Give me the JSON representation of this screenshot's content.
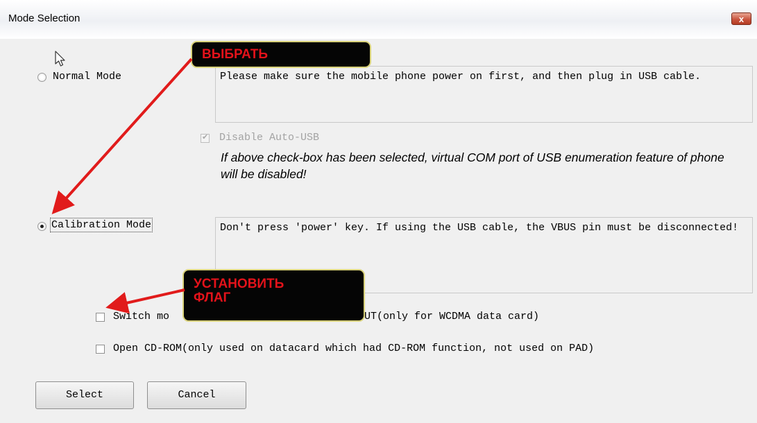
{
  "window": {
    "title": "Mode Selection",
    "close_glyph": "x"
  },
  "normal_mode": {
    "radio_label": "Normal Mode",
    "selected": false,
    "description": "Please make sure the mobile phone power on first, and then plug in USB cable."
  },
  "disable_auto_usb": {
    "label": "Disable Auto-USB",
    "checked": true,
    "enabled": false,
    "note": "If above check-box has been selected, virtual COM port of USB enumeration feature of phone will be disabled!"
  },
  "calibration_mode": {
    "radio_label": "Calibration Mode",
    "selected": true,
    "description": "Don't press 'power' key. If using the USB cable, the VBUS pin must be disconnected!"
  },
  "switch_option": {
    "label_start": "Switch mo",
    "label_end": "UT(only for WCDMA data card)",
    "checked": false
  },
  "cdrom_option": {
    "label": "Open CD-ROM(only used on datacard which  had CD-ROM function, not used on PAD)",
    "checked": false
  },
  "buttons": {
    "select": "Select",
    "cancel": "Cancel"
  },
  "annotations": {
    "select_callout": "ВЫБРАТЬ",
    "flag_callout_line1": "УСТАНОВИТЬ",
    "flag_callout_line2": "ФЛАГ",
    "arrow_color": "#e11b1b"
  },
  "colors": {
    "dialog_background": "#f0f0f0",
    "callout_background": "#050505",
    "callout_text": "#e3121a",
    "callout_border": "#d9d27a"
  },
  "icons": {
    "cursor": "mouse-pointer-icon",
    "close": "close-icon"
  }
}
